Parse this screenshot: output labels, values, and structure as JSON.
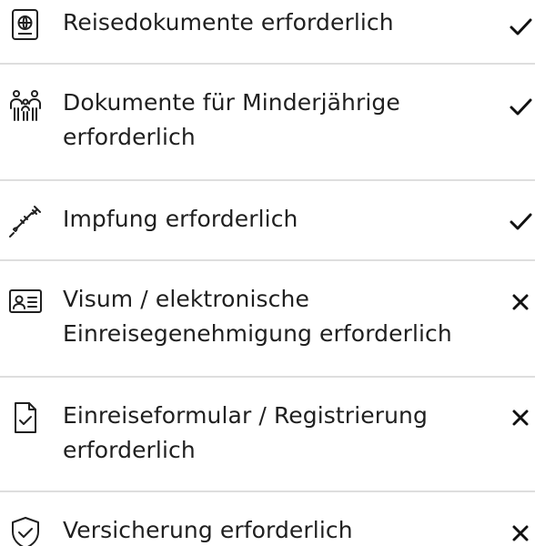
{
  "requirements": [
    {
      "label": "Reisedokumente erforderlich",
      "icon": "passport-icon",
      "status": "check-icon"
    },
    {
      "label": "Dokumente für Minderjährige erforderlich",
      "icon": "family-icon",
      "status": "check-icon"
    },
    {
      "label": "Impfung erforderlich",
      "icon": "syringe-icon",
      "status": "check-icon"
    },
    {
      "label": "Visum / elektronische Einreisegenehmigung erforderlich",
      "icon": "id-card-icon",
      "status": "cross-icon"
    },
    {
      "label": "Einreiseformular / Registrierung erforderlich",
      "icon": "document-check-icon",
      "status": "cross-icon"
    },
    {
      "label": "Versicherung erforderlich",
      "icon": "shield-check-icon",
      "status": "cross-icon"
    }
  ]
}
